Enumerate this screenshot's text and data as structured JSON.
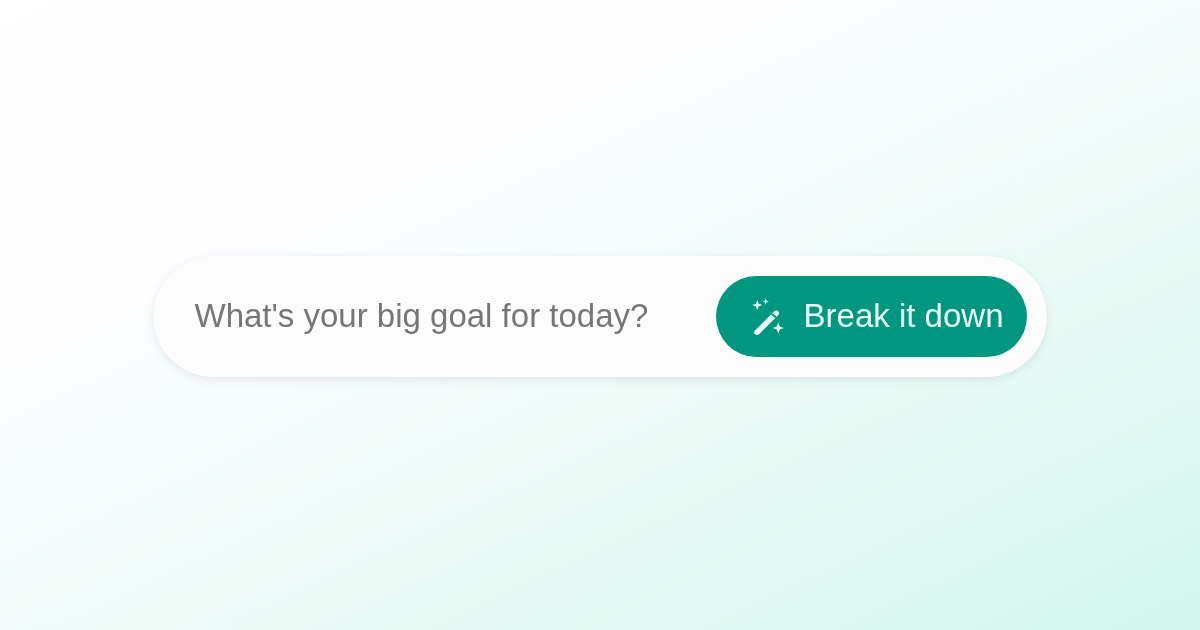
{
  "goal_input": {
    "placeholder": "What's your big goal for today?"
  },
  "button": {
    "label": "Break it down"
  }
}
